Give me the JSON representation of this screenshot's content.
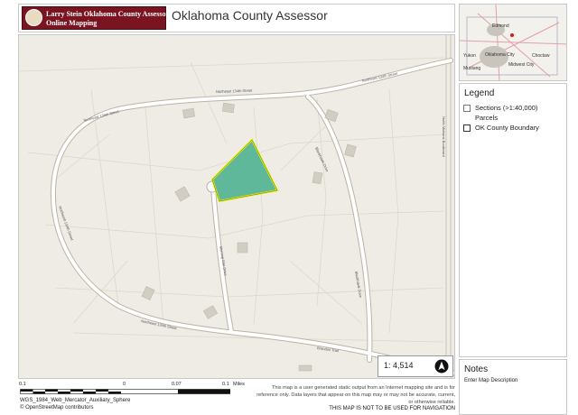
{
  "header": {
    "logo_line1": "Larry Stein Oklahoma County Assessor",
    "logo_line2": "Online Mapping",
    "title": "Oklahoma County Assessor"
  },
  "map": {
    "street_labels": [
      "Northeast 134th Street",
      "Northeast 134th Street",
      "Northeast 134th Street",
      "Northeast 134th Street",
      "Northeast 134th Street",
      "Blackhawk Drive",
      "Blackhawk Drive",
      "Morning Star Drive",
      "Brandon Trail",
      "North Midwest Boulevard"
    ],
    "parcel_fill": "#5fb89a",
    "parcel_outline": "#e8f000",
    "background": "#eeece4"
  },
  "scale": {
    "ratio": "1: 4,514",
    "north_icon": "north-arrow-icon"
  },
  "overview": {
    "labels": [
      "Edmond",
      "Oklahoma City",
      "Choctaw",
      "Yukon",
      "Mustang",
      "Midwest City"
    ]
  },
  "legend": {
    "title": "Legend",
    "items": [
      "Sections (>1:40,000)",
      "Parcels",
      "OK County Boundary"
    ]
  },
  "notes": {
    "title": "Notes",
    "description": "Enter Map Description"
  },
  "scalebar": {
    "ticks": [
      "0.1",
      "0",
      "0.07",
      "0.1"
    ],
    "unit": "Miles"
  },
  "footer": {
    "projection": "WGS_1984_Web_Mercator_Auxiliary_Sphere",
    "copyright": "© OpenStreetMap contributors",
    "disclaimer": "This map is a user generated static output from an Internet mapping site and is for reference only. Data layers that appear on this map may or may not be accurate, current, or otherwise reliable.",
    "nav_warning": "THIS MAP IS NOT TO BE USED FOR NAVIGATION"
  }
}
